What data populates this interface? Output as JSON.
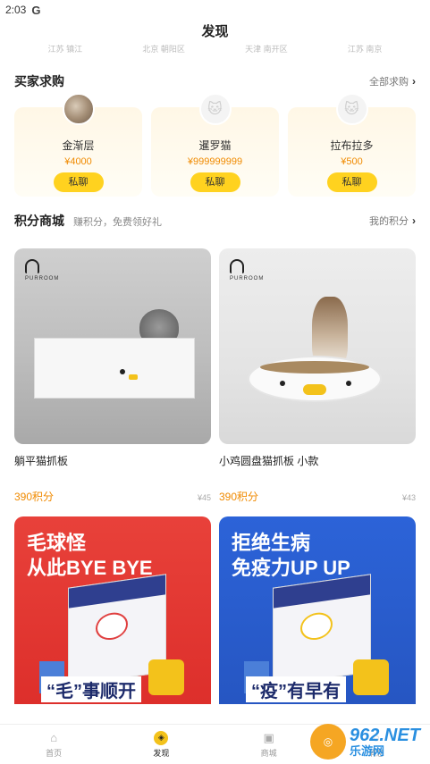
{
  "status_bar": {
    "time": "2:03",
    "indicator": "G"
  },
  "header": {
    "title": "发现"
  },
  "locations": [
    "江苏 镇江",
    "北京 朝阳区",
    "天津 南开区",
    "江苏 南京"
  ],
  "buyers_section": {
    "title": "买家求购",
    "more_label": "全部求购",
    "items": [
      {
        "name": "金渐层",
        "price": "¥4000",
        "chat_label": "私聊",
        "avatar": "photo"
      },
      {
        "name": "暹罗猫",
        "price": "¥999999999",
        "chat_label": "私聊",
        "avatar": "cat-placeholder-icon"
      },
      {
        "name": "拉布拉多",
        "price": "¥500",
        "chat_label": "私聊",
        "avatar": "cat-placeholder-icon"
      }
    ]
  },
  "mall_section": {
    "title": "积分商城",
    "subtitle": "赚积分，免费领好礼",
    "more_label": "我的积分",
    "products": [
      {
        "brand": "PURROOM",
        "name": "躺平猫抓板",
        "points": "390积分",
        "original_price": "¥45"
      },
      {
        "brand": "PURROOM",
        "name": "小鸡圆盘猫抓板 小款",
        "points": "390积分",
        "original_price": "¥43"
      }
    ],
    "banners": [
      {
        "line1": "毛球怪",
        "line2": "从此BYE BYE",
        "bottom": "“毛”事顺开"
      },
      {
        "line1": "拒绝生病",
        "line2": "免疫力UP UP",
        "bottom": "“疫”有早有"
      }
    ]
  },
  "tabbar": {
    "items": [
      {
        "label": "首页",
        "icon": "home-icon",
        "active": false
      },
      {
        "label": "发现",
        "icon": "compass-icon",
        "active": true
      },
      {
        "label": "商城",
        "icon": "shop-icon",
        "active": false
      },
      {
        "label": "消息",
        "icon": "message-icon",
        "active": false
      }
    ]
  },
  "watermark": {
    "number": "962.NET",
    "sub": "乐游网"
  },
  "colors": {
    "accent": "#ffd21f",
    "price": "#f08a00"
  }
}
